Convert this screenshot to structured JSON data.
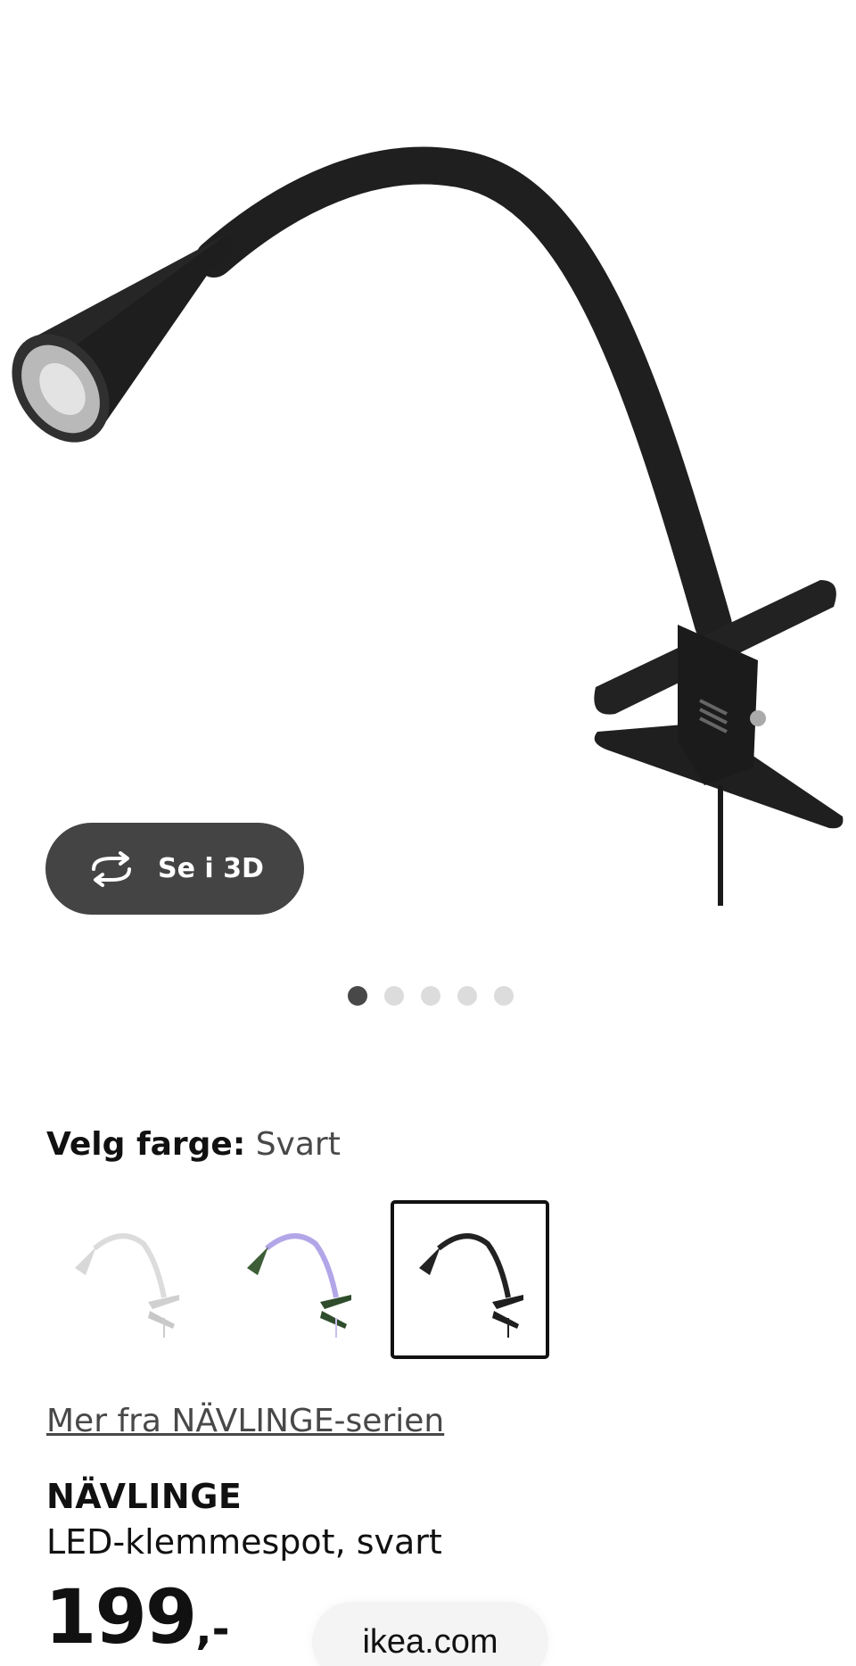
{
  "gallery": {
    "view_3d_label": "Se i 3D",
    "dot_count": 5,
    "active_dot": 1
  },
  "color": {
    "label": "Velg farge:",
    "selected_value": "Svart",
    "options": [
      {
        "name": "white",
        "hex": "#e6e6e6"
      },
      {
        "name": "green-lilac",
        "hex": "#3f5e3a"
      },
      {
        "name": "black",
        "hex": "#1c1c1c"
      }
    ],
    "selected_index": 2
  },
  "series_link": "Mer fra NÄVLINGE-serien",
  "product": {
    "name": "NÄVLINGE",
    "description": "LED-klemmespot, svart",
    "price": "199",
    "price_suffix": ",-"
  },
  "browser": {
    "url": "ikea.com"
  },
  "colors": {
    "pill_bg": "#444444",
    "dot_active": "#484848",
    "dot_inactive": "#dcdcdc"
  }
}
